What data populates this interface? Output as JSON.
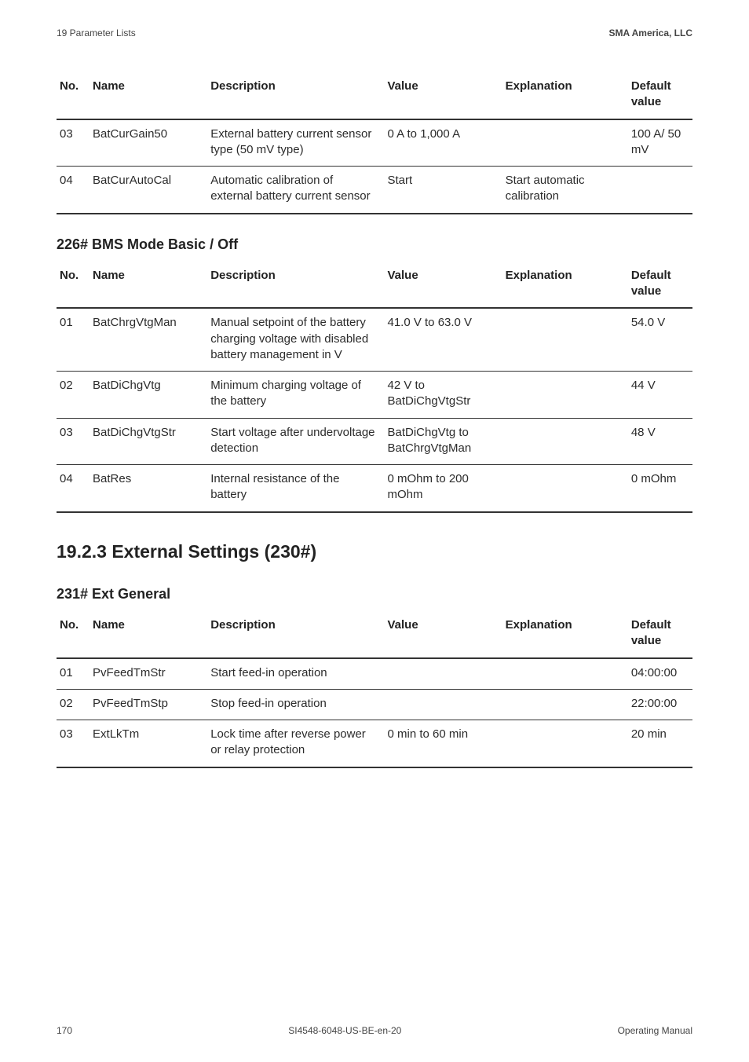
{
  "topbar": {
    "left": "19 Parameter Lists",
    "right": "SMA America, LLC"
  },
  "footer": {
    "page": "170",
    "code": "SI4548-6048-US-BE-en-20",
    "doc": "Operating Manual"
  },
  "headers": {
    "no": "No.",
    "name": "Name",
    "desc": "Description",
    "val": "Value",
    "exp": "Explanation",
    "def": "Default value"
  },
  "tableA": {
    "rows": [
      {
        "no": "03",
        "name": "BatCurGain50",
        "desc": "External battery current sensor type (50 mV type)",
        "val": "0 A to 1,000 A",
        "exp": "",
        "def": "100 A/ 50 mV"
      },
      {
        "no": "04",
        "name": "BatCurAutoCal",
        "desc": "Automatic calibration of external battery current sensor",
        "val": "Start",
        "exp": "Start automatic calibration",
        "def": ""
      }
    ]
  },
  "sectB_title": "226# BMS Mode Basic / Off",
  "tableB": {
    "rows": [
      {
        "no": "01",
        "name": "BatChrgVtgMan",
        "desc": "Manual setpoint of the battery charging voltage with disabled battery management in V",
        "val": "41.0 V to 63.0 V",
        "exp": "",
        "def": "54.0 V"
      },
      {
        "no": "02",
        "name": "BatDiChgVtg",
        "desc": "Minimum charging voltage of the battery",
        "val": "42 V to BatDiChgVtgStr",
        "exp": "",
        "def": "44 V"
      },
      {
        "no": "03",
        "name": "BatDiChgVtgStr",
        "desc": "Start voltage after undervoltage detection",
        "val": "BatDiChgVtg to BatChrgVtgMan",
        "exp": "",
        "def": "48 V"
      },
      {
        "no": "04",
        "name": "BatRes",
        "desc": "Internal resistance of the battery",
        "val": "0 mOhm to 200 mOhm",
        "exp": "",
        "def": "0 mOhm"
      }
    ]
  },
  "subchap_title": "19.2.3 External Settings (230#)",
  "sectC_title": "231# Ext General",
  "tableC": {
    "rows": [
      {
        "no": "01",
        "name": "PvFeedTmStr",
        "desc": "Start feed-in operation",
        "val": "",
        "exp": "",
        "def": "04:00:00"
      },
      {
        "no": "02",
        "name": "PvFeedTmStp",
        "desc": "Stop feed-in operation",
        "val": "",
        "exp": "",
        "def": "22:00:00"
      },
      {
        "no": "03",
        "name": "ExtLkTm",
        "desc": "Lock time after reverse power or relay protection",
        "val": "0 min to 60 min",
        "exp": "",
        "def": "20 min"
      }
    ]
  }
}
